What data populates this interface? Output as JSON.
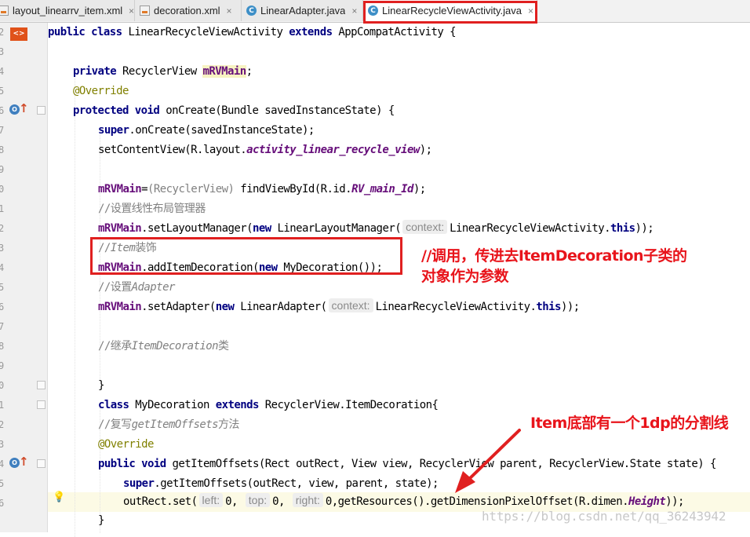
{
  "tabs": [
    {
      "label": "layout_linearrv_item.xml",
      "type": "xml",
      "active": false
    },
    {
      "label": "decoration.xml",
      "type": "xml",
      "active": false
    },
    {
      "label": "LinearAdapter.java",
      "type": "java",
      "active": false
    },
    {
      "label": "LinearRecycleViewActivity.java",
      "type": "java",
      "active": true
    }
  ],
  "tab_close_glyph": "×",
  "file_icon_letter": "C",
  "gutter_badges": {
    "xml": "<>",
    "override": "O"
  },
  "gutter_line_numbers": [
    "2",
    "3",
    "4",
    "5",
    "6",
    "7",
    "8",
    "9",
    "0",
    "1",
    "2",
    "3",
    "4",
    "5",
    "6",
    "7",
    "8",
    "9",
    "0",
    "1",
    "2",
    "3",
    "4",
    "5",
    "6"
  ],
  "code": {
    "l1_a": "public class ",
    "l1_b": "LinearRecycleViewActivity ",
    "l1_c": "extends ",
    "l1_d": "AppCompatActivity {",
    "l2_a": "private ",
    "l2_b": "RecyclerView ",
    "l2_c": "mRVMain",
    "l2_d": ";",
    "l3": "@Override",
    "l4_a": "protected void ",
    "l4_b": "onCreate(Bundle savedInstanceState) {",
    "l5_a": "super",
    "l5_b": ".onCreate(savedInstanceState);",
    "l6_a": "setContentView(R.layout.",
    "l6_b": "activity_linear_recycle_view",
    "l6_c": ");",
    "l7_a": "mRVMain",
    "l7_b": "=",
    "l7_c": "(RecyclerView) ",
    "l7_d": "findViewById(R.id.",
    "l7_e": "RV_main_Id",
    "l7_f": ");",
    "l8": "//设置线性布局管理器",
    "l9_a": "mRVMain",
    "l9_b": ".setLayoutManager(",
    "l9_c": "new ",
    "l9_d": "LinearLayoutManager(",
    "l9_hint": "context:",
    "l9_e": "LinearRecycleViewActivity.",
    "l9_f": "this",
    "l9_g": "));",
    "l10_a": "//",
    "l10_b": "Item",
    "l10_c": "装饰",
    "l11_a": "mRVMain",
    "l11_b": ".addItemDecoration(",
    "l11_c": "new ",
    "l11_d": "MyDecoration());",
    "l12_a": "//设置",
    "l12_b": "Adapter",
    "l13_a": "mRVMain",
    "l13_b": ".setAdapter(",
    "l13_c": "new ",
    "l13_d": "LinearAdapter(",
    "l13_hint": "context:",
    "l13_e": "LinearRecycleViewActivity.",
    "l13_f": "this",
    "l13_g": "));",
    "l14_a": "//继承",
    "l14_b": "ItemDecoration",
    "l14_c": "类",
    "l15": "}",
    "l16_a": "class ",
    "l16_b": "MyDecoration ",
    "l16_c": "extends ",
    "l16_d": "RecyclerView.ItemDecoration{",
    "l17_a": "//复写",
    "l17_b": "getItemOffsets",
    "l17_c": "方法",
    "l18": "@Override",
    "l19_a": "public void ",
    "l19_b": "getItemOffsets(Rect outRect, View view, RecyclerView parent, RecyclerView.State state) {",
    "l20_a": "super",
    "l20_b": ".getItemOffsets(outRect, view, parent, state);",
    "l21_a": "outRect.set(",
    "l21_h1": "left:",
    "l21_b": "0, ",
    "l21_h2": "top:",
    "l21_c": "0, ",
    "l21_h3": "right:",
    "l21_d": "0,getResources().getDimensionPixelOffset(R.dimen.",
    "l21_e": "Height",
    "l21_f": "));",
    "l22": "}"
  },
  "annotations": {
    "note1_line1": "//调用，传进去ItemDecoration子类的",
    "note1_line2": "对象作为参数",
    "note2": "Item底部有一个1dp的分割线"
  },
  "watermark": "https://blog.csdn.net/qq_36243942",
  "colors": {
    "keyword": "#000080",
    "field": "#660e7a",
    "annotation": "#808000",
    "comment": "#808080",
    "highlight_red": "#e02020"
  }
}
